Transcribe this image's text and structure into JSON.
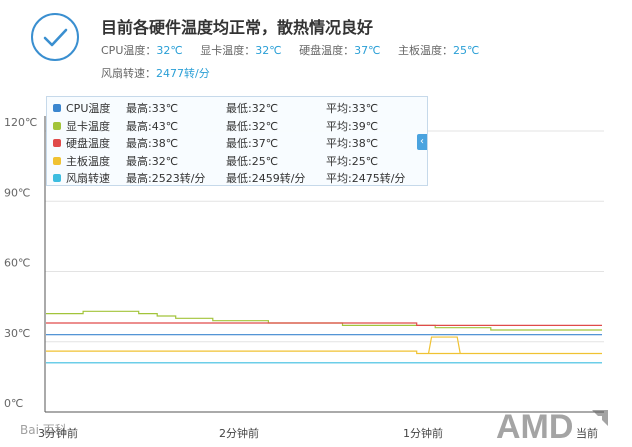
{
  "status": {
    "title": "目前各硬件温度均正常，散热情况良好",
    "icon": "check-icon",
    "temps": [
      {
        "label": "CPU温度：",
        "value": "32℃"
      },
      {
        "label": "显卡温度：",
        "value": "32℃"
      },
      {
        "label": "硬盘温度：",
        "value": "37℃"
      },
      {
        "label": "主板温度：",
        "value": "25℃"
      }
    ],
    "fan": {
      "label": "风扇转速：",
      "value": "2477转/分"
    }
  },
  "legend": [
    {
      "name": "CPU温度",
      "max": "最高:33℃",
      "min": "最低:32℃",
      "avg": "平均:33℃",
      "color": "#3b86cf"
    },
    {
      "name": "显卡温度",
      "max": "最高:43℃",
      "min": "最低:32℃",
      "avg": "平均:39℃",
      "color": "#a2c43a"
    },
    {
      "name": "硬盘温度",
      "max": "最高:38℃",
      "min": "最低:37℃",
      "avg": "平均:38℃",
      "color": "#e04a4a"
    },
    {
      "name": "主板温度",
      "max": "最高:32℃",
      "min": "最低:25℃",
      "avg": "平均:25℃",
      "color": "#f0c232"
    },
    {
      "name": "风扇转速",
      "max": "最高:2523转/分",
      "min": "最低:2459转/分",
      "avg": "平均:2475转/分",
      "color": "#3cbde0"
    }
  ],
  "legend_collapse": "‹",
  "watermarks": {
    "baidu": "Bai 百科",
    "amd": "AMD"
  },
  "chart_data": {
    "type": "line",
    "y_ticks": [
      "0℃",
      "30℃",
      "60℃",
      "90℃",
      "120℃"
    ],
    "ylim": [
      0,
      120
    ],
    "x_ticks": [
      "3分钟前",
      "2分钟前",
      "1分钟前",
      "当前"
    ],
    "grid": true,
    "series": [
      {
        "name": "CPU温度",
        "color": "#3b86cf",
        "values": [
          33,
          33,
          33,
          33,
          33,
          33,
          33,
          33,
          33,
          33,
          33,
          33,
          33,
          33,
          33,
          33,
          33,
          33,
          33,
          33,
          33,
          33,
          33,
          33,
          33,
          33,
          33,
          33,
          33,
          33,
          33
        ]
      },
      {
        "name": "显卡温度",
        "color": "#a2c43a",
        "values": [
          42,
          42,
          43,
          43,
          43,
          42,
          41,
          40,
          40,
          39,
          39,
          39,
          38,
          38,
          38,
          38,
          37,
          37,
          37,
          37,
          37,
          36,
          36,
          36,
          35,
          35,
          35,
          35,
          35,
          35,
          35
        ]
      },
      {
        "name": "硬盘温度",
        "color": "#e04a4a",
        "values": [
          38,
          38,
          38,
          38,
          38,
          38,
          38,
          38,
          38,
          38,
          38,
          38,
          38,
          38,
          38,
          38,
          38,
          38,
          38,
          38,
          37,
          37,
          37,
          37,
          37,
          37,
          37,
          37,
          37,
          37,
          37
        ]
      },
      {
        "name": "主板温度",
        "color": "#f0c232",
        "values": [
          26,
          26,
          26,
          26,
          26,
          26,
          26,
          26,
          26,
          26,
          26,
          26,
          26,
          26,
          26,
          26,
          26,
          26,
          26,
          26,
          25,
          25,
          25,
          25,
          25,
          25,
          25,
          25,
          25,
          25,
          25
        ],
        "spike": {
          "from": 0.688,
          "to": 0.745,
          "value": 32
        }
      },
      {
        "name": "风扇转速",
        "color": "#3cbde0",
        "values": [
          21,
          21,
          21,
          21,
          21,
          21,
          21,
          21,
          21,
          21,
          21,
          21,
          21,
          21,
          21,
          21,
          21,
          21,
          21,
          21,
          21,
          21,
          21,
          21,
          21,
          21,
          21,
          21,
          21,
          21,
          21
        ]
      }
    ]
  }
}
